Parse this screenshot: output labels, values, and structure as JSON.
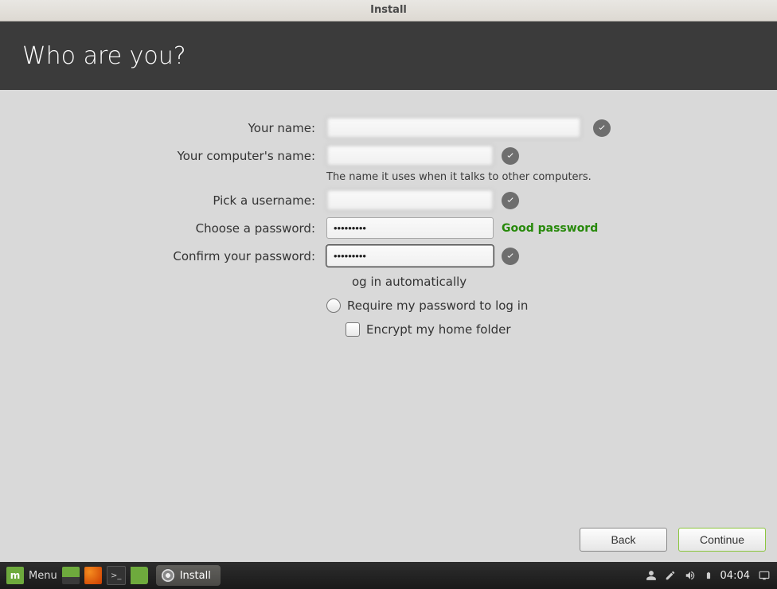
{
  "window": {
    "title": "Install"
  },
  "header": {
    "heading": "Who are you?"
  },
  "form": {
    "name_label": "Your name:",
    "name_value": "",
    "computer_label": "Your computer's name:",
    "computer_value": "",
    "computer_helper": "The name it uses when it talks to other computers.",
    "username_label": "Pick a username:",
    "username_value": "",
    "password_label": "Choose a password:",
    "password_value": "•••••••••",
    "password_strength": "Good password",
    "confirm_label": "Confirm your password:",
    "confirm_value": "•••••••••",
    "auto_login_label": "og in automatically",
    "require_pw_label": "Require my password to log in",
    "encrypt_label": "Encrypt my home folder"
  },
  "buttons": {
    "back": "Back",
    "continue": "Continue"
  },
  "taskbar": {
    "menu": "Menu",
    "active_task": "Install",
    "clock": "04:04"
  }
}
